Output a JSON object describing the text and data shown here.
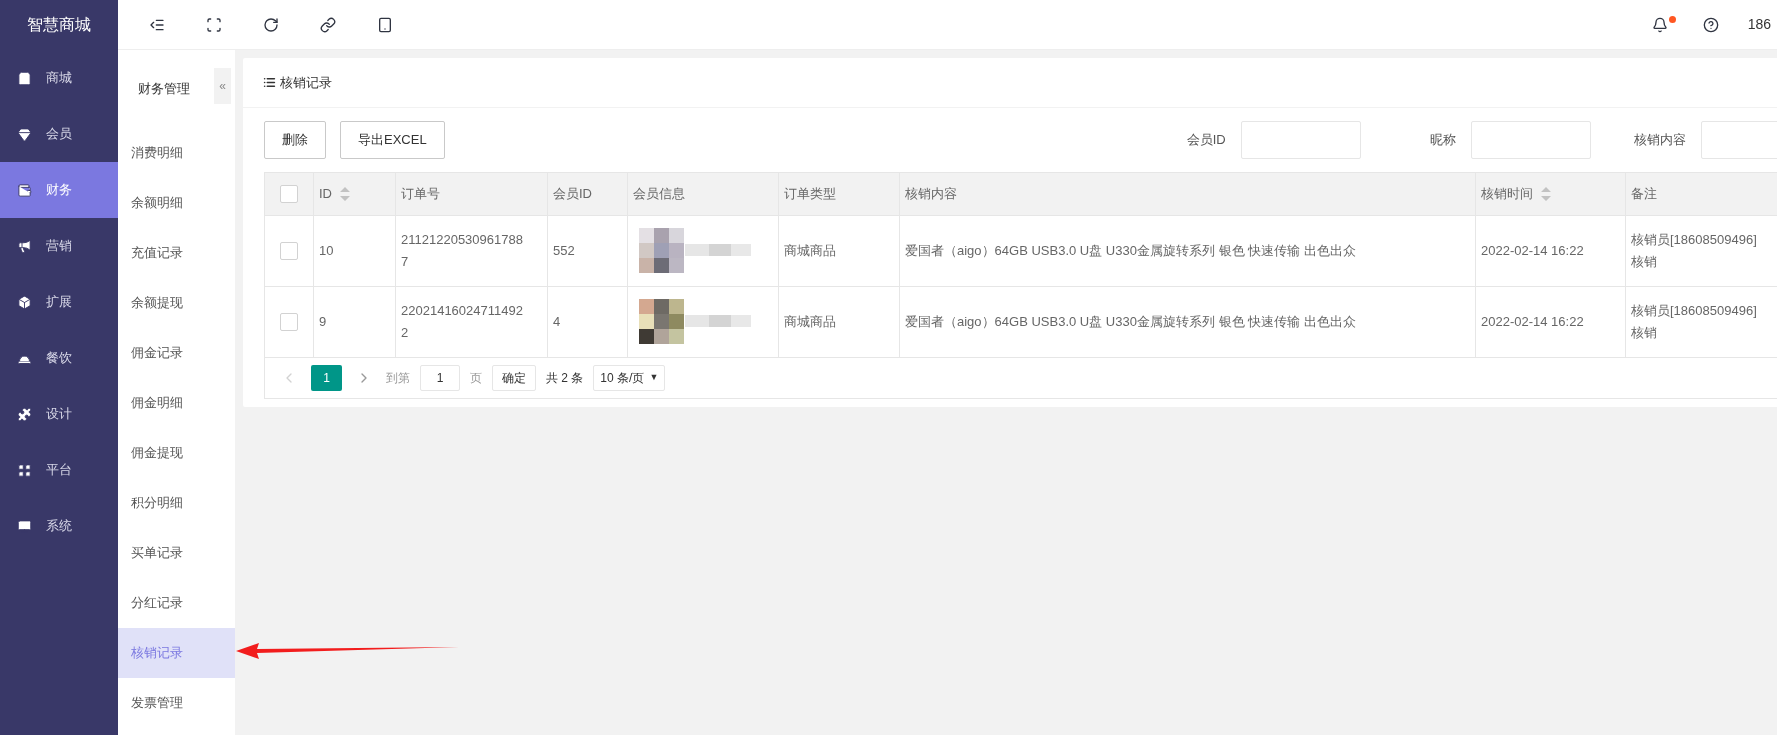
{
  "logo": "智慧商城",
  "nav": [
    {
      "label": "商城",
      "selected": false
    },
    {
      "label": "会员",
      "selected": false
    },
    {
      "label": "财务",
      "selected": true
    },
    {
      "label": "营销",
      "selected": false
    },
    {
      "label": "扩展",
      "selected": false
    },
    {
      "label": "餐饮",
      "selected": false
    },
    {
      "label": "设计",
      "selected": false
    },
    {
      "label": "平台",
      "selected": false
    },
    {
      "label": "系统",
      "selected": false
    }
  ],
  "header": {
    "unread": true,
    "user": "186"
  },
  "submenu": {
    "title": "财务管理",
    "collapse": "«",
    "items": [
      {
        "label": "消费明细",
        "selected": false
      },
      {
        "label": "余额明细",
        "selected": false
      },
      {
        "label": "充值记录",
        "selected": false
      },
      {
        "label": "余额提现",
        "selected": false
      },
      {
        "label": "佣金记录",
        "selected": false
      },
      {
        "label": "佣金明细",
        "selected": false
      },
      {
        "label": "佣金提现",
        "selected": false
      },
      {
        "label": "积分明细",
        "selected": false
      },
      {
        "label": "买单记录",
        "selected": false
      },
      {
        "label": "分红记录",
        "selected": false
      },
      {
        "label": "核销记录",
        "selected": true
      },
      {
        "label": "发票管理",
        "selected": false
      }
    ]
  },
  "card": {
    "title": "核销记录",
    "buttons": [
      "删除",
      "导出EXCEL"
    ],
    "filters": [
      {
        "label": "会员ID"
      },
      {
        "label": "昵称"
      },
      {
        "label": "核销内容"
      }
    ]
  },
  "table": {
    "select_all": {
      "checked": false
    },
    "columns": [
      {
        "label": "ID",
        "sortable": true
      },
      {
        "label": "订单号",
        "sortable": false
      },
      {
        "label": "会员ID",
        "sortable": false
      },
      {
        "label": "会员信息",
        "sortable": false
      },
      {
        "label": "订单类型",
        "sortable": false
      },
      {
        "label": "核销内容",
        "sortable": false
      },
      {
        "label": "核销时间",
        "sortable": true
      },
      {
        "label": "备注",
        "sortable": false
      }
    ],
    "rows": [
      {
        "checked": false,
        "id": "10",
        "order_no": "211212205309617887",
        "member_id": "552",
        "order_type": "商城商品",
        "content": "爱国者（aigo）64GB USB3.0 U盘 U330金属旋转系列 银色 快速传输 出色出众",
        "time": "2022-02-14 16:22",
        "remark": "核销员[18608509496]核销"
      },
      {
        "checked": false,
        "id": "9",
        "order_no": "220214160247114922",
        "member_id": "4",
        "order_type": "商城商品",
        "content": "爱国者（aigo）64GB USB3.0 U盘 U330金属旋转系列 银色 快速传输 出色出众",
        "time": "2022-02-14 16:22",
        "remark": "核销员[18608509496]核销"
      }
    ]
  },
  "pagination": {
    "prev": {
      "disabled": true
    },
    "pages": [
      {
        "label": "1",
        "selected": true
      }
    ],
    "next": {
      "disabled": false
    },
    "goto_label": "到第",
    "goto_value": "1",
    "page_unit": "页",
    "confirm": "确定",
    "total": "共 2 条",
    "page_size": "10 条/页",
    "page_size_caret": "▼"
  }
}
